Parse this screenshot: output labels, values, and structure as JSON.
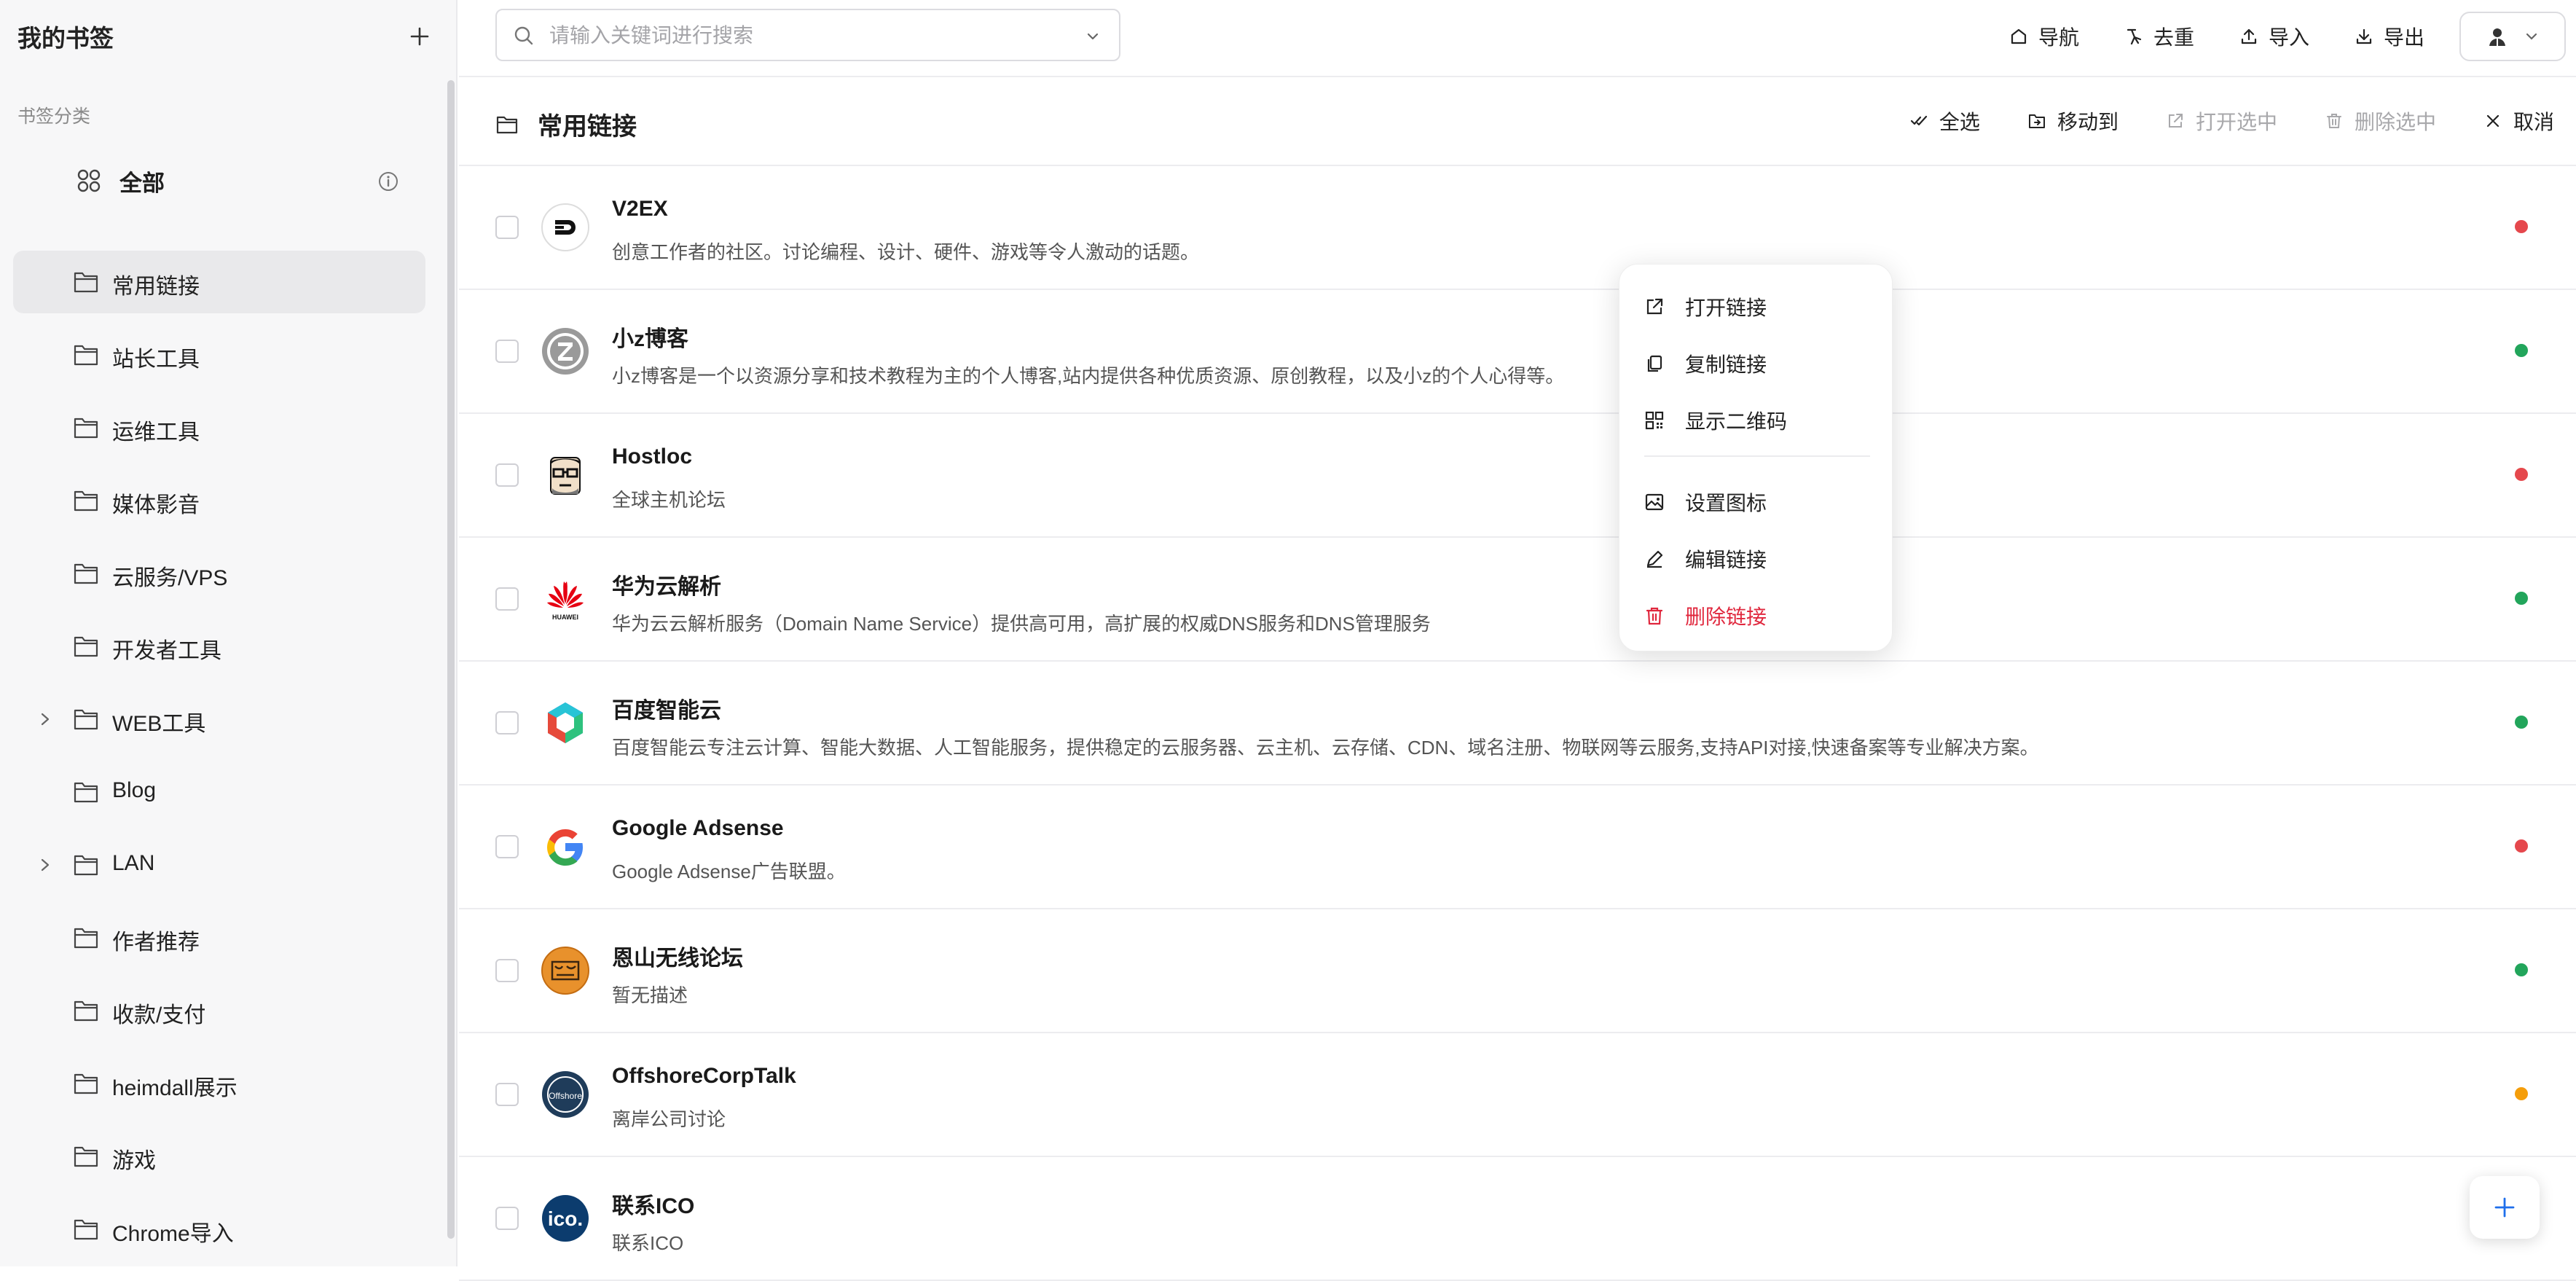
{
  "sidebar": {
    "title": "我的书签",
    "section_label": "书签分类",
    "all_label": "全部",
    "items": [
      {
        "label": "常用链接",
        "active": true,
        "expandable": false
      },
      {
        "label": "站长工具",
        "active": false,
        "expandable": false
      },
      {
        "label": "运维工具",
        "active": false,
        "expandable": false
      },
      {
        "label": "媒体影音",
        "active": false,
        "expandable": false
      },
      {
        "label": "云服务/VPS",
        "active": false,
        "expandable": false
      },
      {
        "label": "开发者工具",
        "active": false,
        "expandable": false
      },
      {
        "label": "WEB工具",
        "active": false,
        "expandable": true
      },
      {
        "label": "Blog",
        "active": false,
        "expandable": false
      },
      {
        "label": "LAN",
        "active": false,
        "expandable": true
      },
      {
        "label": "作者推荐",
        "active": false,
        "expandable": false
      },
      {
        "label": "收款/支付",
        "active": false,
        "expandable": false
      },
      {
        "label": "heimdall展示",
        "active": false,
        "expandable": false
      },
      {
        "label": "游戏",
        "active": false,
        "expandable": false
      },
      {
        "label": "Chrome导入",
        "active": false,
        "expandable": false
      }
    ]
  },
  "search": {
    "placeholder": "请输入关键词进行搜索"
  },
  "topbar": {
    "nav": "导航",
    "dedupe": "去重",
    "import": "导入",
    "export": "导出"
  },
  "list_header": {
    "title": "常用链接",
    "select_all": "全选",
    "move_to": "移动到",
    "open_selected": "打开选中",
    "delete_selected": "删除选中",
    "cancel": "取消"
  },
  "bookmarks": [
    {
      "title": "V2EX",
      "desc": "创意工作者的社区。讨论编程、设计、硬件、游戏等令人激动的话题。",
      "status_color": "#e5484d",
      "logo": "v2ex-logo"
    },
    {
      "title": "小z博客",
      "desc": "小z博客是一个以资源分享和技术教程为主的个人博客,站内提供各种优质资源、原创教程，以及小z的个人心得等。",
      "status_color": "#22a55b",
      "logo": "z-logo"
    },
    {
      "title": "Hostloc",
      "desc": "全球主机论坛",
      "status_color": "#e5484d",
      "logo": "hostloc-logo"
    },
    {
      "title": "华为云解析",
      "desc": "华为云云解析服务（Domain Name Service）提供高可用，高扩展的权威DNS服务和DNS管理服务",
      "status_color": "#22a55b",
      "logo": "huawei-logo"
    },
    {
      "title": "百度智能云",
      "desc": "百度智能云专注云计算、智能大数据、人工智能服务，提供稳定的云服务器、云主机、云存储、CDN、域名注册、物联网等云服务,支持API对接,快速备案等专业解决方案。",
      "status_color": "#22a55b",
      "logo": "baidu-cloud-logo"
    },
    {
      "title": "Google Adsense",
      "desc": "Google Adsense广告联盟。",
      "status_color": "#e5484d",
      "logo": "google-logo"
    },
    {
      "title": "恩山无线论坛",
      "desc": "暂无描述",
      "status_color": "#22a55b",
      "logo": "right-logo"
    },
    {
      "title": "OffshoreCorpTalk",
      "desc": "离岸公司讨论",
      "status_color": "#f59e0b",
      "logo": "offshore-logo"
    },
    {
      "title": "联系ICO",
      "desc": "联系ICO",
      "status_color": "#22a55b",
      "logo": "ico-logo"
    }
  ],
  "context_menu": {
    "open_link": "打开链接",
    "copy_link": "复制链接",
    "show_qr": "显示二维码",
    "set_icon": "设置图标",
    "edit_link": "编辑链接",
    "delete_link": "删除链接"
  },
  "colors": {
    "danger": "#e0273d",
    "accent_blue": "#1f6feb"
  }
}
